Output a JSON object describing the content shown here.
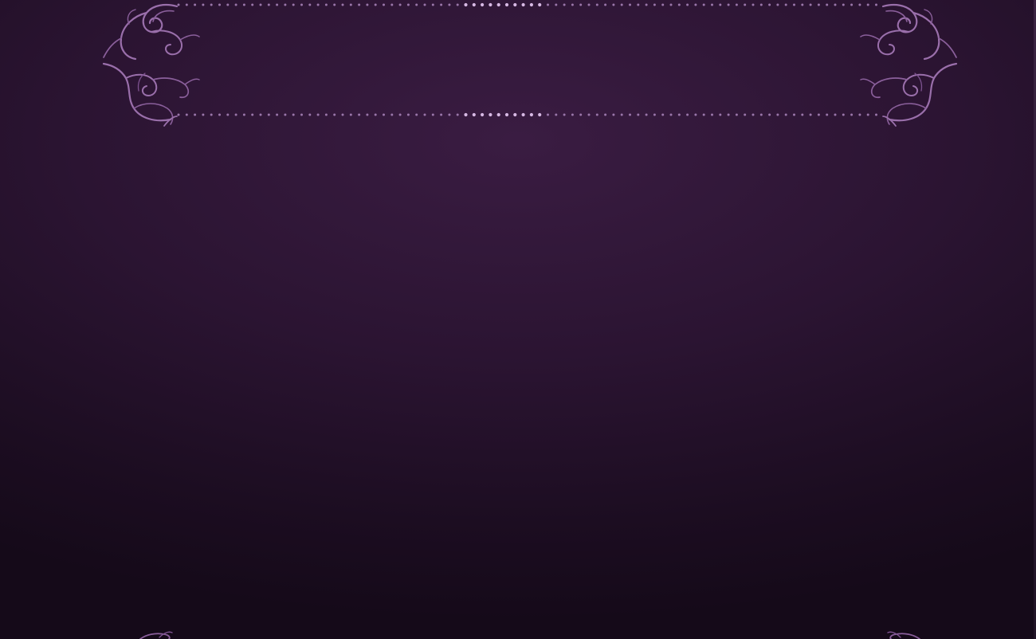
{
  "page": {
    "background_colors": [
      "#3a1c42",
      "#2b1432",
      "#1c0d21",
      "#150a19"
    ],
    "ornament_color": "#9a6fab",
    "ornament_highlight": "#c9a6d6"
  },
  "header_banner": {
    "title": ""
  },
  "icons": {
    "top_left": "flourish-scroll-icon",
    "top_right": "flourish-scroll-icon",
    "bottom_left": "flourish-scroll-icon",
    "bottom_right": "flourish-scroll-icon"
  }
}
